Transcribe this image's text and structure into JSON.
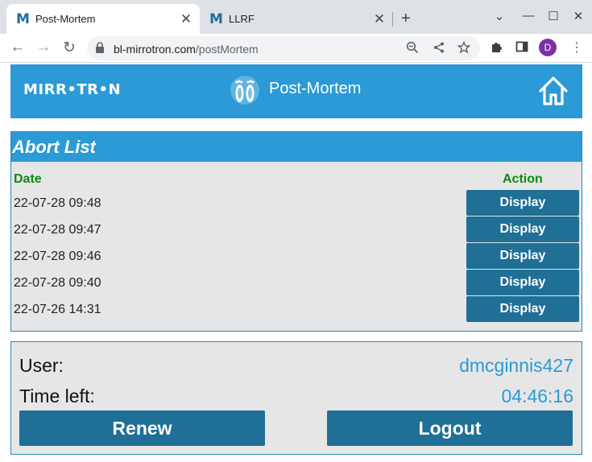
{
  "browser": {
    "tabs": [
      {
        "favicon": "M",
        "title": "Post-Mortem",
        "close": "✕"
      },
      {
        "favicon": "M",
        "title": "LLRF",
        "close": "✕"
      }
    ],
    "new_tab": "+",
    "window_controls": {
      "minimize": "⌄",
      "restore": "—",
      "maximize": "☐",
      "close": "✕"
    },
    "url_host": "bl-mirrotron.com",
    "url_path": "/postMortem",
    "profile_initial": "D",
    "icons": [
      "back-arrow-icon",
      "forward-arrow-icon",
      "reload-icon",
      "lock-icon",
      "zoom-out-icon",
      "share-icon",
      "star-icon",
      "extensions-icon",
      "side-panel-icon",
      "menu-icon"
    ]
  },
  "header": {
    "logo": "MIRR•TR•N",
    "title": "Post-Mortem",
    "icons": [
      "feet-icon",
      "home-icon"
    ]
  },
  "abort_list": {
    "title": "Abort List",
    "col_date": "Date",
    "col_action": "Action",
    "rows": [
      {
        "date": "22-07-28 09:48",
        "action": "Display"
      },
      {
        "date": "22-07-28 09:47",
        "action": "Display"
      },
      {
        "date": "22-07-28 09:46",
        "action": "Display"
      },
      {
        "date": "22-07-28 09:40",
        "action": "Display"
      },
      {
        "date": "22-07-26 14:31",
        "action": "Display"
      }
    ]
  },
  "session": {
    "user_label": "User:",
    "user_value": "dmcginnis427",
    "time_label": "Time left:",
    "time_value": "04:46:16",
    "renew": "Renew",
    "logout": "Logout"
  },
  "colors": {
    "accent": "#2b9ad6",
    "button": "#1f6f96",
    "header_green": "#0f8a0f",
    "panel": "#e6e6e6"
  }
}
